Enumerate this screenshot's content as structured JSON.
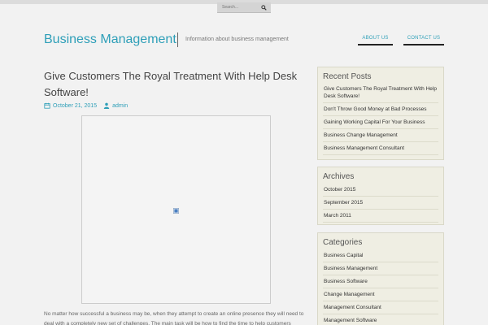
{
  "search": {
    "placeholder": "Search..."
  },
  "header": {
    "site_title": "Business Management",
    "tagline": "Information about business management",
    "nav": [
      {
        "label": "ABOUT US"
      },
      {
        "label": "CONTACT US"
      }
    ]
  },
  "post": {
    "title": "Give Customers The Royal Treatment With Help Desk Software!",
    "date": "October 21, 2015",
    "author": "admin",
    "excerpt": "No matter how successful a business may be, when they attempt to create an online presence they will need to deal with a completely new set of challenges. The main task will be how to find the time to help customers"
  },
  "sidebar": {
    "recent": {
      "title": "Recent Posts",
      "items": [
        {
          "label": "Give Customers The Royal Treatment With Help Desk Software!"
        },
        {
          "label": "Don't Throw Good Money at Bad Processes"
        },
        {
          "label": "Gaining Working Capital For Your Business"
        },
        {
          "label": "Business Change Management"
        },
        {
          "label": "Business Management Consultant"
        }
      ]
    },
    "archives": {
      "title": "Archives",
      "items": [
        {
          "label": "October 2015"
        },
        {
          "label": "September 2015"
        },
        {
          "label": "March 2011"
        }
      ]
    },
    "categories": {
      "title": "Categories",
      "items": [
        {
          "label": "Business Capital"
        },
        {
          "label": "Business Management"
        },
        {
          "label": "Business Software"
        },
        {
          "label": "Change Management"
        },
        {
          "label": "Management Consultant"
        },
        {
          "label": "Management Software"
        }
      ]
    }
  }
}
